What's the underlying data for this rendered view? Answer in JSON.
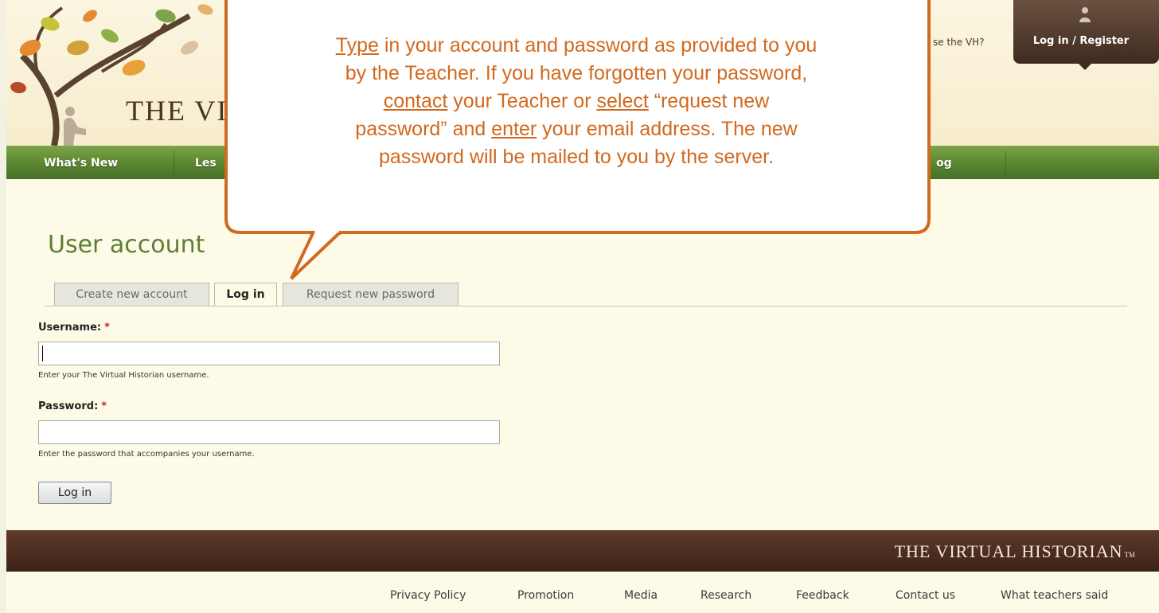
{
  "header": {
    "site_name": "THE VI",
    "top_question": "se the VH?",
    "login_register": "Log in / Register"
  },
  "nav": {
    "items": [
      "What's New",
      "Les",
      "og"
    ]
  },
  "main": {
    "page_title": "User account",
    "tabs": [
      {
        "label": "Create new account",
        "active": false
      },
      {
        "label": "Log in",
        "active": true
      },
      {
        "label": "Request new password",
        "active": false
      }
    ],
    "username": {
      "label": "Username:",
      "required_marker": "*",
      "value": "",
      "help": "Enter your The Virtual Historian username."
    },
    "password": {
      "label": "Password:",
      "required_marker": "*",
      "value": "",
      "help": "Enter the password that accompanies your username."
    },
    "submit_label": "Log in"
  },
  "footer": {
    "brand": "THE VIRTUAL HISTORIAN",
    "brand_tm": "TM",
    "links": [
      "Privacy Policy",
      "Promotion",
      "Media",
      "Research",
      "Feedback",
      "Contact us",
      "What teachers said"
    ]
  },
  "callout": {
    "line1_pre": "",
    "line1_u": "Type",
    "line1_post": " in your account and password as provided to you",
    "line2": "by the Teacher. If you have forgotten your password,",
    "line3_u1": "contact",
    "line3_mid": " your Teacher or ",
    "line3_u2": "select",
    "line3_post": " “request new",
    "line4_pre": "password” and ",
    "line4_u": "enter",
    "line4_post": " your email address. The new",
    "line5": "password will be mailed to you by the server."
  },
  "colors": {
    "accent_orange": "#d2691e",
    "nav_green": "#5a8530",
    "title_green": "#5d7f34",
    "footer_brown": "#4a2c20",
    "required_red": "#cc1f1f"
  }
}
